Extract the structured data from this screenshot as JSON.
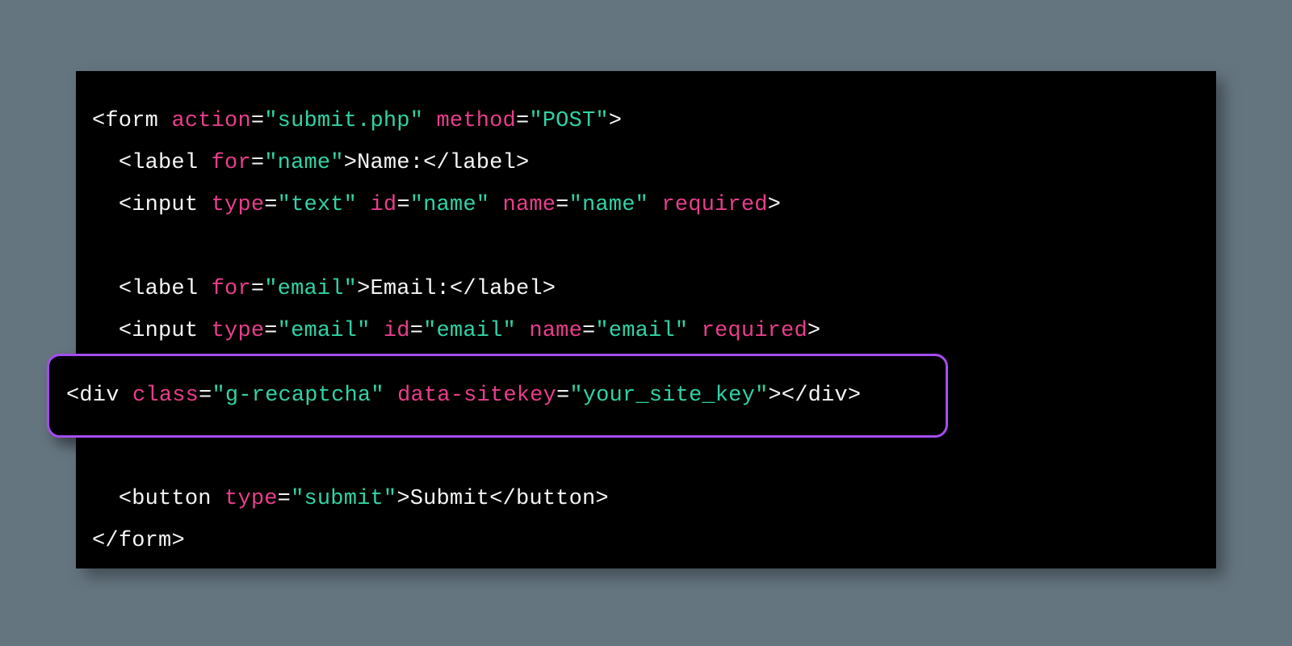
{
  "code": {
    "line1": {
      "open": "<",
      "tag": "form",
      "sp1": " ",
      "attr1": "action",
      "eq1": "=",
      "val1": "\"submit.php\"",
      "sp2": " ",
      "attr2": "method",
      "eq2": "=",
      "val2": "\"POST\"",
      "close": ">"
    },
    "line2": {
      "indent": "  ",
      "open": "<",
      "tag": "label",
      "sp1": " ",
      "attr1": "for",
      "eq1": "=",
      "val1": "\"name\"",
      "close1": ">",
      "text": "Name:",
      "openc": "</",
      "tagc": "label",
      "closec": ">"
    },
    "line3": {
      "indent": "  ",
      "open": "<",
      "tag": "input",
      "sp1": " ",
      "attr1": "type",
      "eq1": "=",
      "val1": "\"text\"",
      "sp2": " ",
      "attr2": "id",
      "eq2": "=",
      "val2": "\"name\"",
      "sp3": " ",
      "attr3": "name",
      "eq3": "=",
      "val3": "\"name\"",
      "sp4": " ",
      "attr4": "required",
      "close": ">"
    },
    "line4": {
      "indent": "  ",
      "open": "<",
      "tag": "label",
      "sp1": " ",
      "attr1": "for",
      "eq1": "=",
      "val1": "\"email\"",
      "close1": ">",
      "text": "Email:",
      "openc": "</",
      "tagc": "label",
      "closec": ">"
    },
    "line5": {
      "indent": "  ",
      "open": "<",
      "tag": "input",
      "sp1": " ",
      "attr1": "type",
      "eq1": "=",
      "val1": "\"email\"",
      "sp2": " ",
      "attr2": "id",
      "eq2": "=",
      "val2": "\"email\"",
      "sp3": " ",
      "attr3": "name",
      "eq3": "=",
      "val3": "\"email\"",
      "sp4": " ",
      "attr4": "required",
      "close": ">"
    },
    "highlight": {
      "open": "<",
      "tag": "div",
      "sp1": " ",
      "attr1": "class",
      "eq1": "=",
      "val1": "\"g-recaptcha\"",
      "sp2": " ",
      "attr2": "data-sitekey",
      "eq2": "=",
      "val2": "\"your_site_key\"",
      "close": ">",
      "openc": "</",
      "tagc": "div",
      "closec": ">"
    },
    "line7": {
      "indent": "  ",
      "open": "<",
      "tag": "button",
      "sp1": " ",
      "attr1": "type",
      "eq1": "=",
      "val1": "\"submit\"",
      "close1": ">",
      "text": "Submit",
      "openc": "</",
      "tagc": "button",
      "closec": ">"
    },
    "line8": {
      "openc": "</",
      "tagc": "form",
      "closec": ">"
    }
  }
}
